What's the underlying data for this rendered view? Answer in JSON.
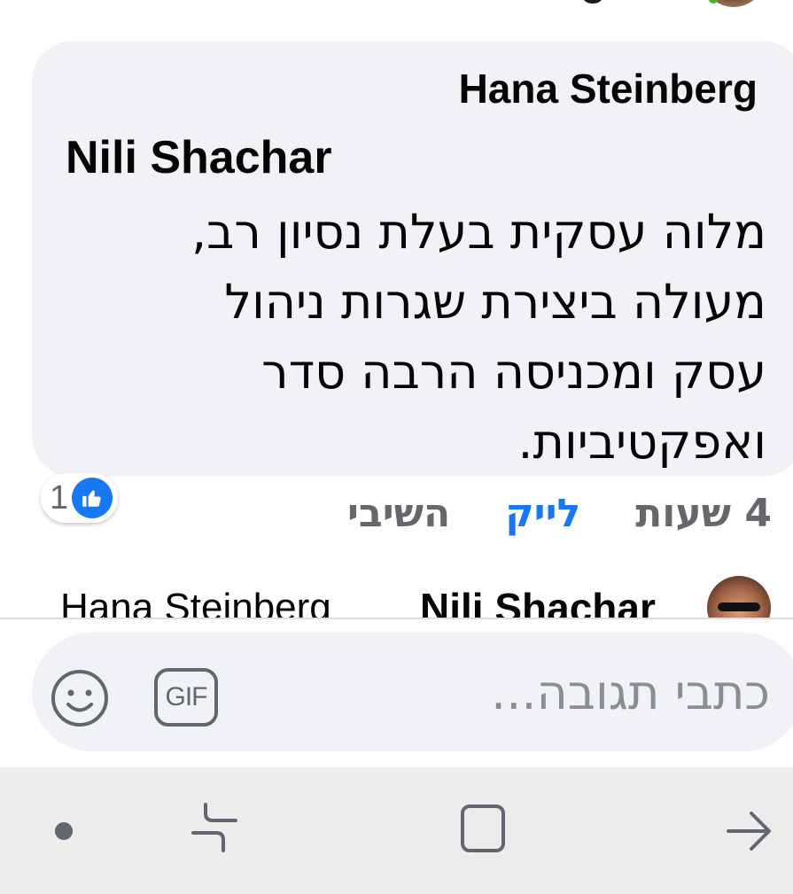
{
  "comment": {
    "reply_to": "Hana Steinberg",
    "author": "Nili Shachar",
    "text_lines": [
      "מלוה עסקית בעלת נסיון רב,",
      "מעולה ביצירת שגרות ניהול",
      "עסק ומכניסה הרבה סדר",
      "ואפקטיביות."
    ]
  },
  "reactions": {
    "count": "1",
    "icon": "thumbs-up-icon",
    "color": "#1877f2"
  },
  "actions": {
    "time": "4 שעות",
    "like": "לייק",
    "reply": "השיבי"
  },
  "reply_preview": {
    "author": "Nili Shachar",
    "reply_to": "Hana Steinberg"
  },
  "composer": {
    "placeholder": "כתבי תגובה...",
    "gif_label": "GIF"
  },
  "navbar": {
    "buttons": [
      "dot-icon",
      "recents-icon",
      "home-icon",
      "back-icon"
    ]
  }
}
